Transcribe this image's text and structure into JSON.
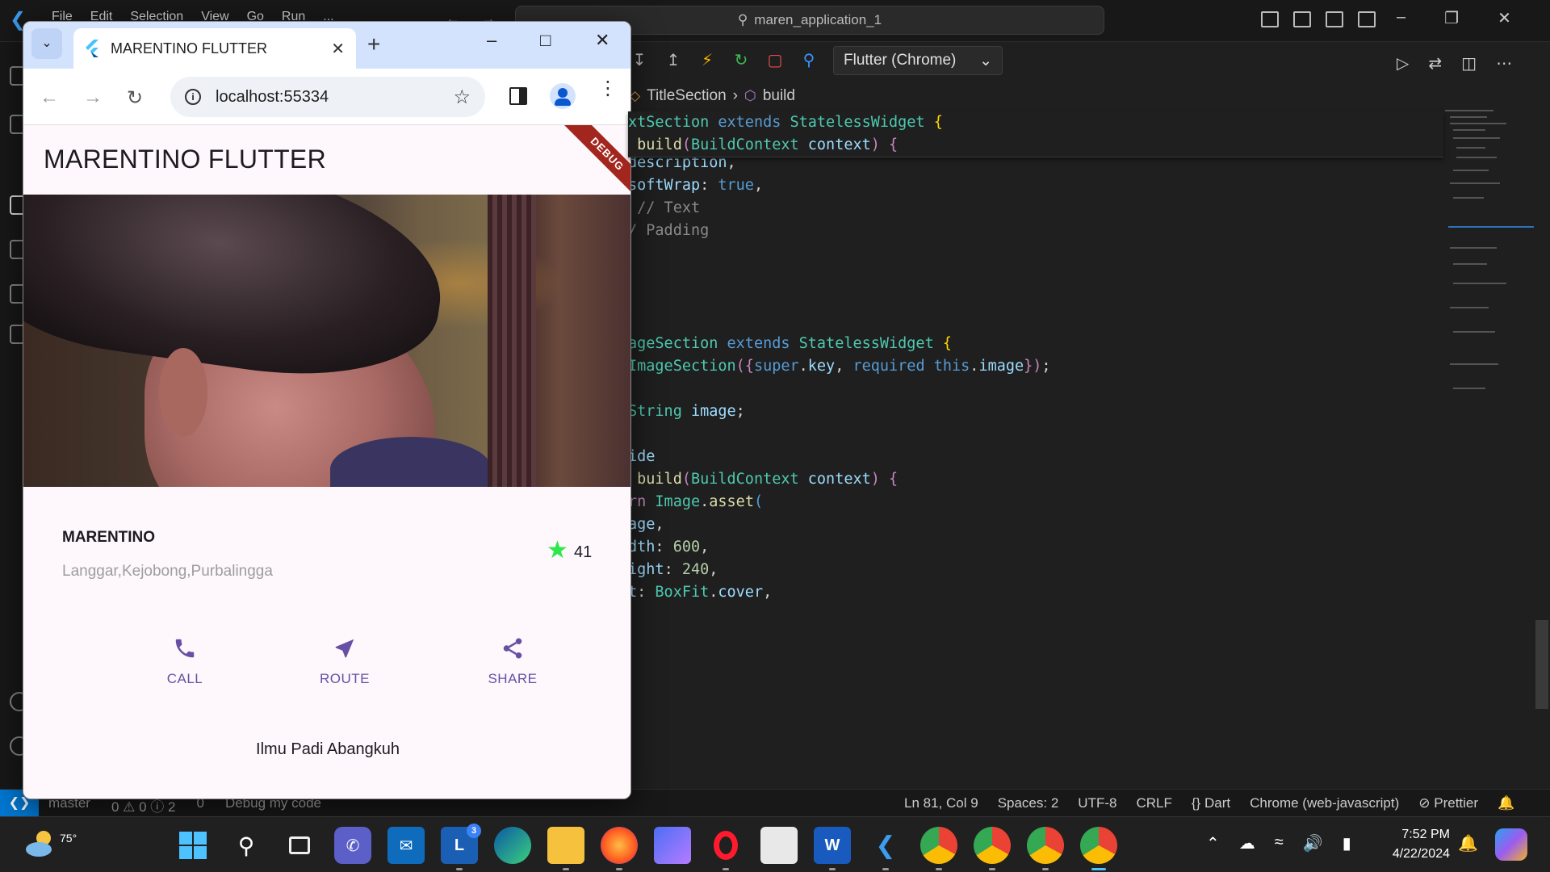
{
  "vscode": {
    "menu": [
      "File",
      "Edit",
      "Selection",
      "View",
      "Go",
      "Run",
      "..."
    ],
    "command_center": "maren_application_1",
    "device": "Flutter (Chrome)",
    "breadcrumb": [
      "TitleSection",
      "build"
    ],
    "status": {
      "branch": "master",
      "problems": "0 ⚠ 0 ⓘ 2",
      "ports": "0",
      "debug": "Debug my code",
      "position": "Ln 81, Col 9",
      "spaces": "Spaces: 2",
      "encoding": "UTF-8",
      "eol": "CRLF",
      "language": "Dart",
      "runtime": "Chrome (web-javascript)",
      "formatter": "Prettier"
    }
  },
  "browser": {
    "tab_title": "MARENTINO FLUTTER",
    "url": "localhost:55334"
  },
  "app": {
    "appbar_title": "MARENTINO FLUTTER",
    "debug_banner": "DEBUG",
    "name": "MARENTINO",
    "address": "Langgar,Kejobong,Purbalingga",
    "rating": "41",
    "buttons": [
      {
        "icon": "phone-icon",
        "label": "CALL"
      },
      {
        "icon": "near-me-icon",
        "label": "ROUTE"
      },
      {
        "icon": "share-icon",
        "label": "SHARE"
      }
    ],
    "description": "Ilmu Padi Abangkuh",
    "accent_color": "#6750a4",
    "star_color": "#2ee84a"
  },
  "taskbar": {
    "weather_temp": "75°",
    "mail_badge": "3",
    "time": "7:52 PM",
    "date": "4/22/2024"
  }
}
